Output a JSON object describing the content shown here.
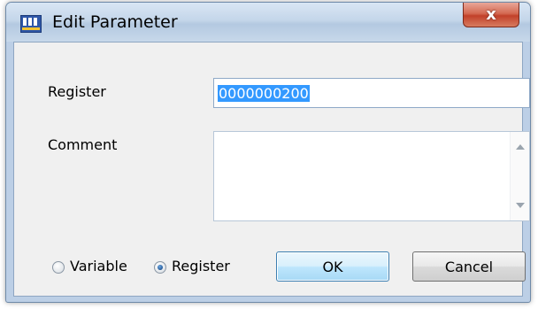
{
  "window": {
    "title": "Edit Parameter",
    "close_glyph": "x",
    "app_icon": "edit-parameter-app-icon",
    "accent": "#3399ff"
  },
  "form": {
    "register_label": "Register",
    "register_value": "0000000200",
    "comment_label": "Comment",
    "comment_value": ""
  },
  "options": {
    "variable_label": "Variable",
    "register_label": "Register",
    "selected": "Register"
  },
  "buttons": {
    "ok_label": "OK",
    "cancel_label": "Cancel"
  }
}
